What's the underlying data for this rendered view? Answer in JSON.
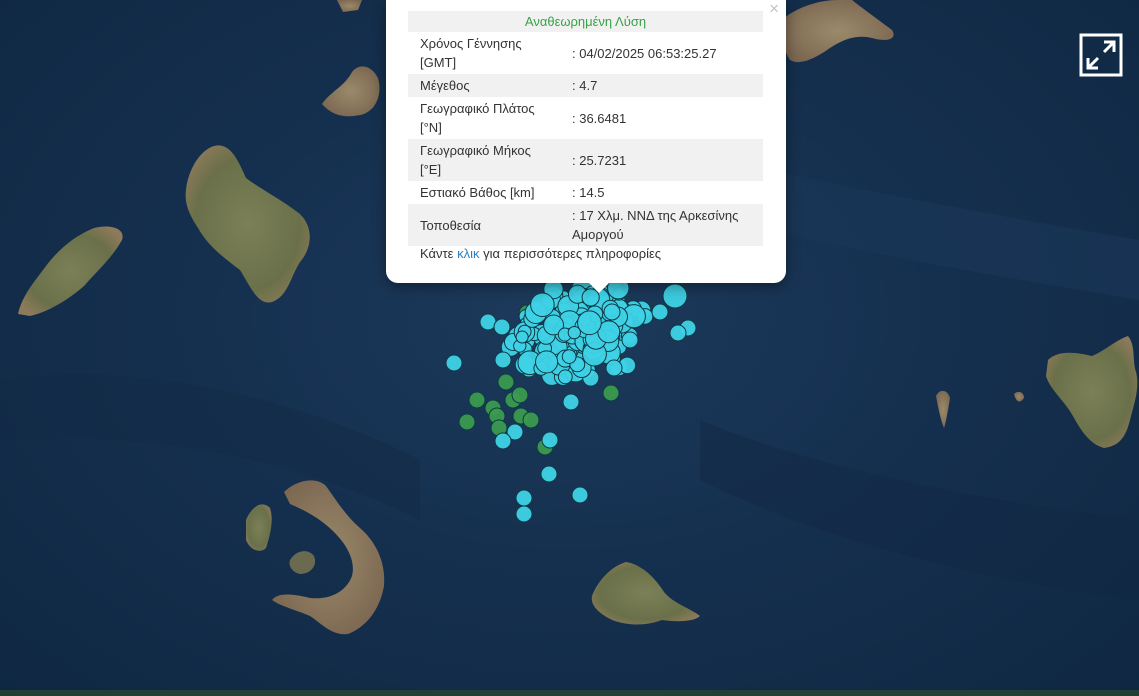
{
  "popup": {
    "title": "Αναθεωρημένη Λύση",
    "close_symbol": "×",
    "rows": [
      {
        "label": "Χρόνος Γέννησης [GMT]",
        "value": ": 04/02/2025 06:53:25.27"
      },
      {
        "label": "Μέγεθος",
        "value": ": 4.7"
      },
      {
        "label": "Γεωγραφικό Πλάτος [°N]",
        "value": ": 36.6481"
      },
      {
        "label": "Γεωγραφικό Μήκος [°E]",
        "value": ": 25.7231"
      },
      {
        "label": "Εστιακό Βάθος [km]",
        "value": ": 14.5"
      },
      {
        "label": "Τοποθεσία",
        "value": ": 17 Χλμ. ΝΝΔ της Αρκεσίνης Αμοργού"
      }
    ],
    "more_prefix": "Κάντε ",
    "more_link": "κλικ",
    "more_suffix": " για περισσότερες πληροφορίες"
  },
  "map": {
    "sea_color": "#15304f",
    "land_color": "#6f7550",
    "icons": {
      "fullscreen": "fullscreen-icon",
      "close": "close-icon"
    }
  },
  "markers": {
    "cyan_color": "#3fd2e6",
    "green_color": "#3a9a4e"
  }
}
